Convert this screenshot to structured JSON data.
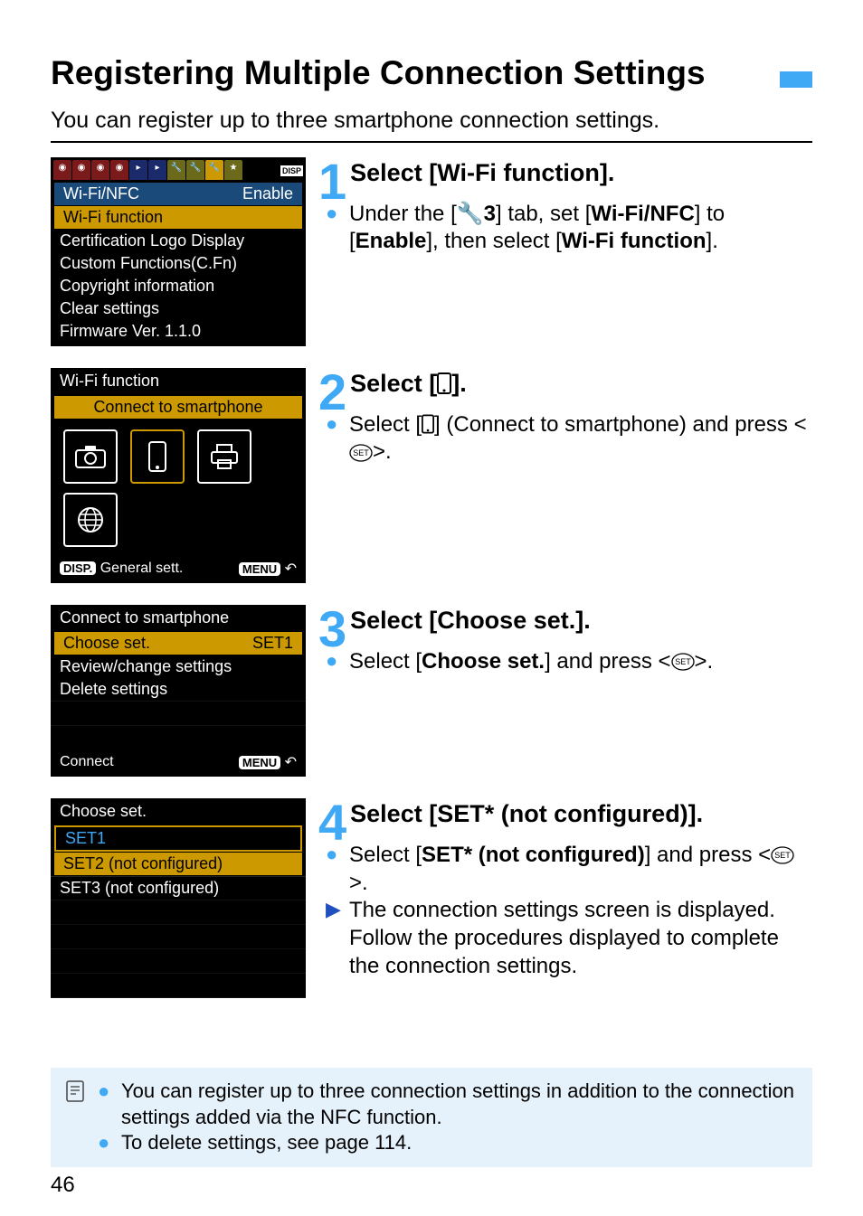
{
  "title": "Registering Multiple Connection Settings",
  "intro": "You can register up to three smartphone connection settings.",
  "lcd1": {
    "disp": "DISP",
    "items": [
      {
        "label": "Wi-Fi/NFC",
        "value": "Enable"
      },
      {
        "label": "Wi-Fi function"
      },
      {
        "label": "Certification Logo Display"
      },
      {
        "label": "Custom Functions(C.Fn)"
      },
      {
        "label": "Copyright information"
      },
      {
        "label": "Clear settings"
      },
      {
        "label": "Firmware Ver. 1.1.0"
      }
    ]
  },
  "lcd2": {
    "title": "Wi-Fi function",
    "subtitle": "Connect to smartphone",
    "disp_label": "DISP.",
    "general": "General sett.",
    "menu": "MENU"
  },
  "lcd3": {
    "title": "Connect to smartphone",
    "items": [
      {
        "label": "Choose set.",
        "value": "SET1"
      },
      {
        "label": "Review/change settings"
      },
      {
        "label": "Delete settings"
      }
    ],
    "connect": "Connect",
    "menu": "MENU"
  },
  "lcd4": {
    "title": "Choose set.",
    "items": [
      {
        "label": "SET1"
      },
      {
        "label": "SET2 (not configured)"
      },
      {
        "label": "SET3 (not configured)"
      }
    ]
  },
  "steps": {
    "s1": {
      "num": "1",
      "head": "Select [Wi-Fi function].",
      "b1_pre": "Under the [",
      "b1_tab": "3",
      "b1_mid": "] tab, set [",
      "b1_bold1": "Wi-Fi/NFC",
      "b1_mid2": "] to [",
      "b1_bold2": "Enable",
      "b1_mid3": "], then select [",
      "b1_bold3": "Wi-Fi function",
      "b1_end": "]."
    },
    "s2": {
      "num": "2",
      "head_pre": "Select [",
      "head_post": "].",
      "b1_pre": "Select [",
      "b1_mid": "] (Connect to smartphone) and press <",
      "b1_end": ">."
    },
    "s3": {
      "num": "3",
      "head": "Select [Choose set.].",
      "b1_pre": "Select [",
      "b1_bold": "Choose set.",
      "b1_mid": "] and press <",
      "b1_end": ">."
    },
    "s4": {
      "num": "4",
      "head": "Select [SET* (not configured)].",
      "b1_pre": "Select [",
      "b1_bold": "SET* (not configured)",
      "b1_mid": "] and press <",
      "b1_end": ">.",
      "b2": "The connection settings screen is displayed. Follow the procedures displayed to complete the connection settings."
    }
  },
  "notes": {
    "n1": "You can register up to three connection settings in addition to the connection settings added via the NFC function.",
    "n2": "To delete settings, see page 114."
  },
  "page_no": "46"
}
